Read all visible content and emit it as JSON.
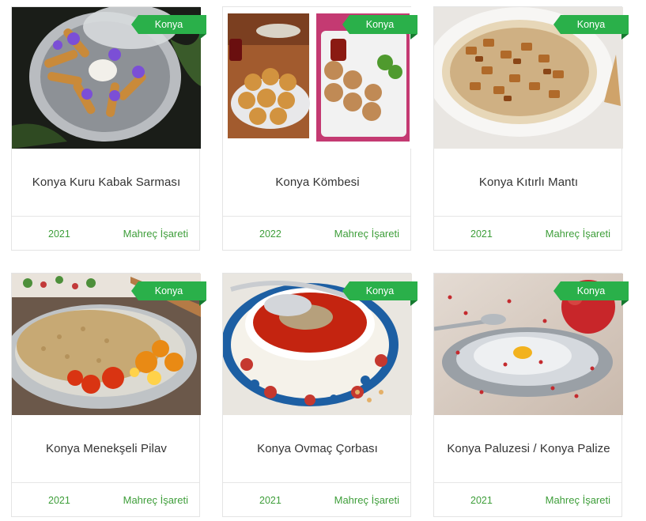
{
  "cards": [
    {
      "title": "Konya Kuru Kabak Sarması",
      "badge": "Konya",
      "year": "2021",
      "mark": "Mahreç İşareti",
      "photo": "stuffed-zucchini-rolls-photo"
    },
    {
      "title": "Konya Kömbesi",
      "badge": "Konya",
      "year": "2022",
      "mark": "Mahreç İşareti",
      "photo": "kombe-pastry-photo"
    },
    {
      "title": "Konya Kıtırlı Mantı",
      "badge": "Konya",
      "year": "2021",
      "mark": "Mahreç İşareti",
      "photo": "crispy-manti-photo"
    },
    {
      "title": "Konya Menekşeli Pilav",
      "badge": "Konya",
      "year": "2021",
      "mark": "Mahreç İşareti",
      "photo": "bulgur-pilaf-photo"
    },
    {
      "title": "Konya Ovmaç Çorbası",
      "badge": "Konya",
      "year": "2021",
      "mark": "Mahreç İşareti",
      "photo": "ovmac-soup-photo"
    },
    {
      "title": "Konya Paluzesi / Konya Palize",
      "badge": "Konya",
      "year": "2021",
      "mark": "Mahreç İşareti",
      "photo": "paluze-dessert-photo"
    }
  ],
  "colors": {
    "accent": "#2ab04a",
    "link": "#3e9e3a"
  }
}
